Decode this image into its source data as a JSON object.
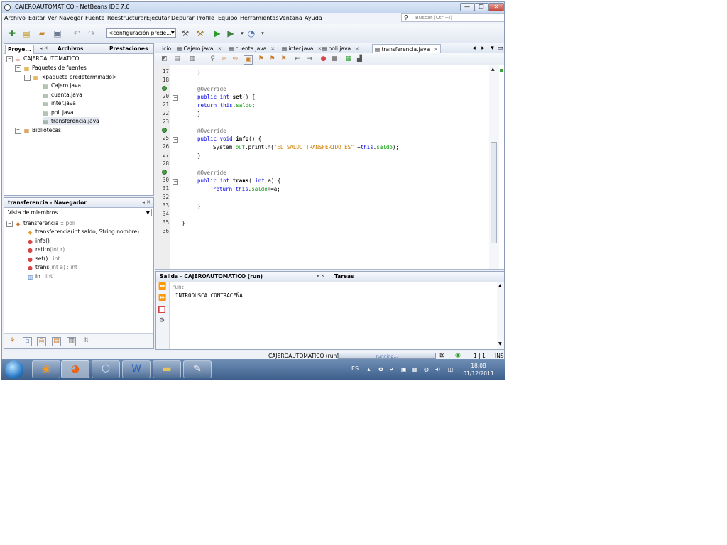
{
  "window": {
    "title": "CAJEROAUTOMATICO - NetBeans IDE 7.0",
    "controls": {
      "minimize": "—",
      "maximize": "❐",
      "close": "✕"
    }
  },
  "menu": {
    "items": [
      "Archivo",
      "Editar",
      "Ver",
      "Navegar",
      "Fuente",
      "Reestructurar",
      "Ejecutar",
      "Depurar",
      "Profile",
      "Equipo",
      "Herramientas",
      "Ventana",
      "Ayuda"
    ],
    "search_placeholder": "Buscar (Ctrl+I)"
  },
  "toolbar": {
    "configuration": "<configuración prede..."
  },
  "projects_panel": {
    "tabs": [
      "Proye...",
      "Archivos",
      "Prestaciones"
    ],
    "tree": [
      {
        "label": "CAJEROAUTOMATICO",
        "icon": "project-icon"
      },
      {
        "label": "Paquetes de fuentes",
        "icon": "source-packages-icon"
      },
      {
        "label": "<paquete predeterminado>",
        "icon": "package-icon"
      },
      {
        "label": "Cajero.java",
        "icon": "java-file-icon"
      },
      {
        "label": "cuenta.java",
        "icon": "java-file-icon"
      },
      {
        "label": "inter.java",
        "icon": "java-file-icon"
      },
      {
        "label": "poli.java",
        "icon": "java-file-icon"
      },
      {
        "label": "transferencia.java",
        "icon": "java-file-icon"
      },
      {
        "label": "Bibliotecas",
        "icon": "libraries-icon"
      }
    ]
  },
  "navigator": {
    "title": "transferencia - Navegador",
    "view": "Vista de miembros",
    "class_name": "transferencia",
    "class_super": ":: poli",
    "members": [
      {
        "name": "transferencia",
        "sig": "(int saldo, String nombre)",
        "type": ""
      },
      {
        "name": "info()",
        "sig": "",
        "type": ""
      },
      {
        "name": "retiro",
        "sig": "(int r)",
        "type": ""
      },
      {
        "name": "set()",
        "sig": "",
        "type": ": int"
      },
      {
        "name": "trans",
        "sig": "(int a)",
        "type": ": int"
      },
      {
        "name": "in",
        "sig": "",
        "type": ": int"
      }
    ]
  },
  "editor": {
    "tabs": [
      "...icio",
      "Cajero.java",
      "cuenta.java",
      "inter.java",
      "poli.java",
      "transferencia.java"
    ],
    "active_tab": "transferencia.java",
    "line_numbers": [
      "17",
      "18",
      "19",
      "20",
      "21",
      "22",
      "23",
      "24",
      "25",
      "26",
      "27",
      "28",
      "29",
      "30",
      "31",
      "32",
      "33",
      "34",
      "35",
      "36"
    ],
    "code": {
      "l17": "}",
      "l19": "@Override",
      "l20_a": "public int ",
      "l20_b": "set",
      "l20_c": "() {",
      "l21_a": "return ",
      "l21_b": "this",
      "l21_c": ".",
      "l21_d": "saldo",
      "l21_e": ";",
      "l22": "}",
      "l24": "@Override",
      "l25_a": "public void ",
      "l25_b": "info",
      "l25_c": "() {",
      "l26_a": "System.",
      "l26_b": "out",
      "l26_c": ".println(",
      "l26_d": "\"EL SALDO TRANSFERIDO ES\"",
      "l26_e": " +",
      "l26_f": "this",
      "l26_g": ".",
      "l26_h": "saldo",
      "l26_i": ");",
      "l27": "}",
      "l29": "@Override",
      "l30_a": "public int ",
      "l30_b": "trans",
      "l30_c": "( ",
      "l30_d": "int",
      "l30_e": " a) {",
      "l31_a": "return ",
      "l31_b": "this",
      "l31_c": ".",
      "l31_d": "saldo",
      "l31_e": "+=a;",
      "l33": "}",
      "l35": "}"
    }
  },
  "output": {
    "title": "Salida - CAJEROAUTOMATICO (run)",
    "tasks_tab": "Tareas",
    "lines": [
      "run:",
      "INTRODUSCA CONTRACEÑA"
    ]
  },
  "status": {
    "project": "CAJEROAUTOMATICO (run)",
    "progress_text": "running...",
    "position": "1 | 1",
    "mode": "INS"
  },
  "taskbar": {
    "language": "ES",
    "time": "18:08",
    "date": "01/12/2011"
  }
}
